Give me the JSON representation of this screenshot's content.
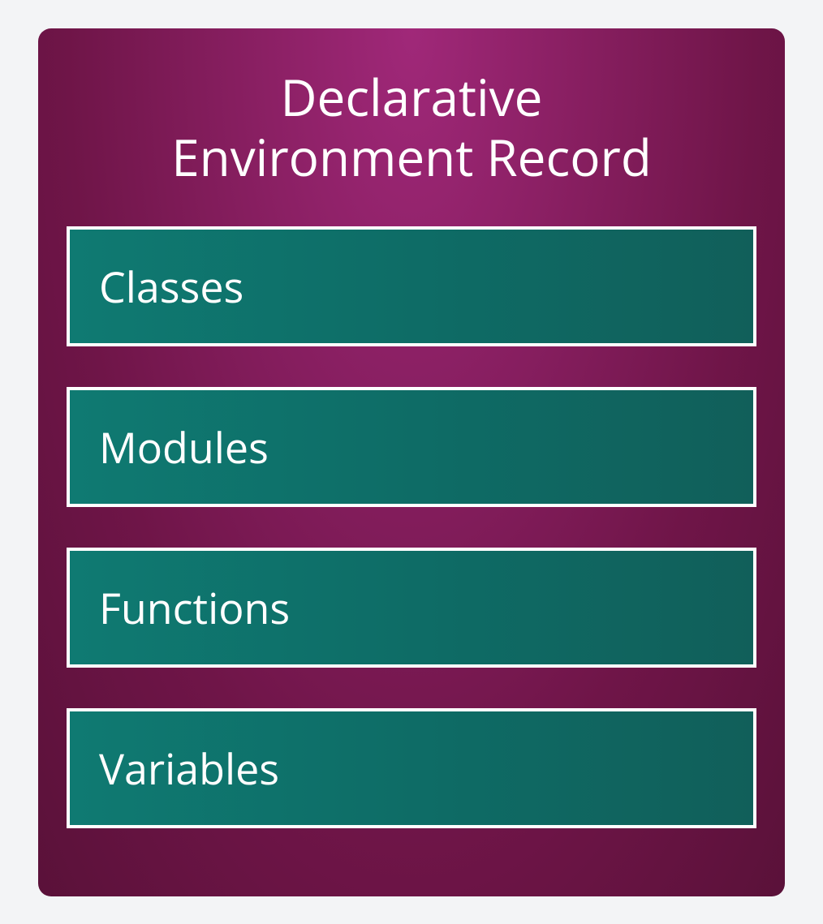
{
  "title_line1": "Declarative",
  "title_line2": "Environment Record",
  "items": [
    {
      "label": "Classes"
    },
    {
      "label": "Modules"
    },
    {
      "label": "Functions"
    },
    {
      "label": "Variables"
    }
  ]
}
